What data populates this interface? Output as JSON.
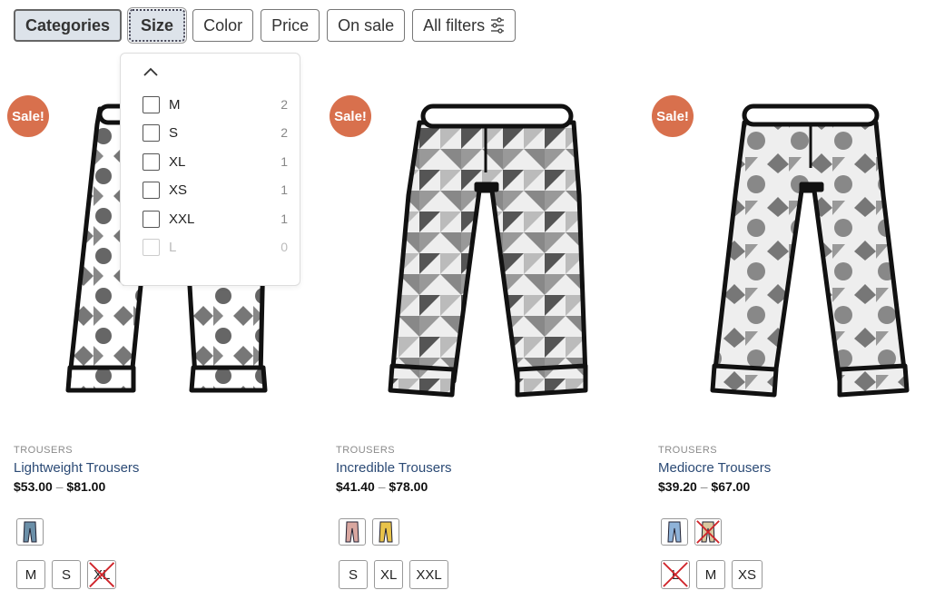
{
  "filters": [
    {
      "label": "Categories",
      "state": "active"
    },
    {
      "label": "Size",
      "state": "open"
    },
    {
      "label": "Color",
      "state": ""
    },
    {
      "label": "Price",
      "state": ""
    },
    {
      "label": "On sale",
      "state": ""
    },
    {
      "label": "All filters",
      "state": "",
      "icon": "sliders-icon"
    }
  ],
  "size_dropdown": {
    "options": [
      {
        "label": "M",
        "count": "2",
        "disabled": false
      },
      {
        "label": "S",
        "count": "2",
        "disabled": false
      },
      {
        "label": "XL",
        "count": "1",
        "disabled": false
      },
      {
        "label": "XS",
        "count": "1",
        "disabled": false
      },
      {
        "label": "XXL",
        "count": "1",
        "disabled": false
      },
      {
        "label": "L",
        "count": "0",
        "disabled": true
      }
    ]
  },
  "products": [
    {
      "badge": "Sale!",
      "category": "TROUSERS",
      "title": "Lightweight Trousers",
      "price_min": "$53.00",
      "price_sep": "–",
      "price_max": "$81.00",
      "swatches": [
        {
          "color": "#6b8fa8",
          "unavailable": false
        }
      ],
      "sizes": [
        {
          "label": "M",
          "unavailable": false
        },
        {
          "label": "S",
          "unavailable": false
        },
        {
          "label": "XL",
          "unavailable": true
        }
      ]
    },
    {
      "badge": "Sale!",
      "category": "TROUSERS",
      "title": "Incredible Trousers",
      "price_min": "$41.40",
      "price_sep": "–",
      "price_max": "$78.00",
      "swatches": [
        {
          "color": "#d9a7a0",
          "unavailable": false
        },
        {
          "color": "#e8c34a",
          "unavailable": false
        }
      ],
      "sizes": [
        {
          "label": "S",
          "unavailable": false
        },
        {
          "label": "XL",
          "unavailable": false
        },
        {
          "label": "XXL",
          "unavailable": false
        }
      ]
    },
    {
      "badge": "Sale!",
      "category": "TROUSERS",
      "title": "Mediocre Trousers",
      "price_min": "$39.20",
      "price_sep": "–",
      "price_max": "$67.00",
      "swatches": [
        {
          "color": "#8fb3d9",
          "unavailable": false
        },
        {
          "color": "#d9c8a0",
          "unavailable": true
        }
      ],
      "sizes": [
        {
          "label": "L",
          "unavailable": true
        },
        {
          "label": "M",
          "unavailable": false
        },
        {
          "label": "XS",
          "unavailable": false
        }
      ]
    }
  ],
  "colors": {
    "sale_badge": "#d8704d",
    "title_link": "#2b4a75",
    "filter_active_bg": "#dde3ea",
    "unavailable_cross": "#d0242a"
  }
}
